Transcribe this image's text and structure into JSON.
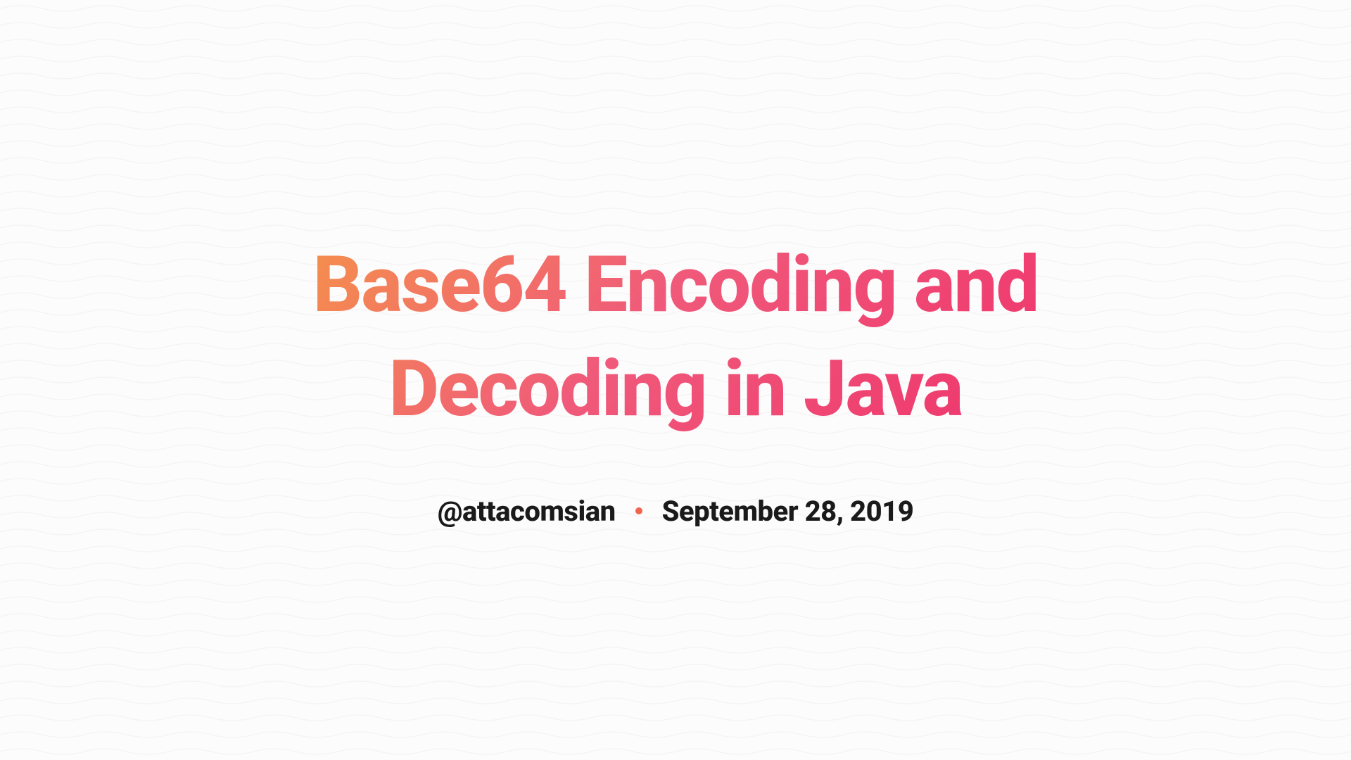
{
  "title": "Base64 Encoding and Decoding in Java",
  "author": "@attacomsian",
  "date": "September 28, 2019"
}
